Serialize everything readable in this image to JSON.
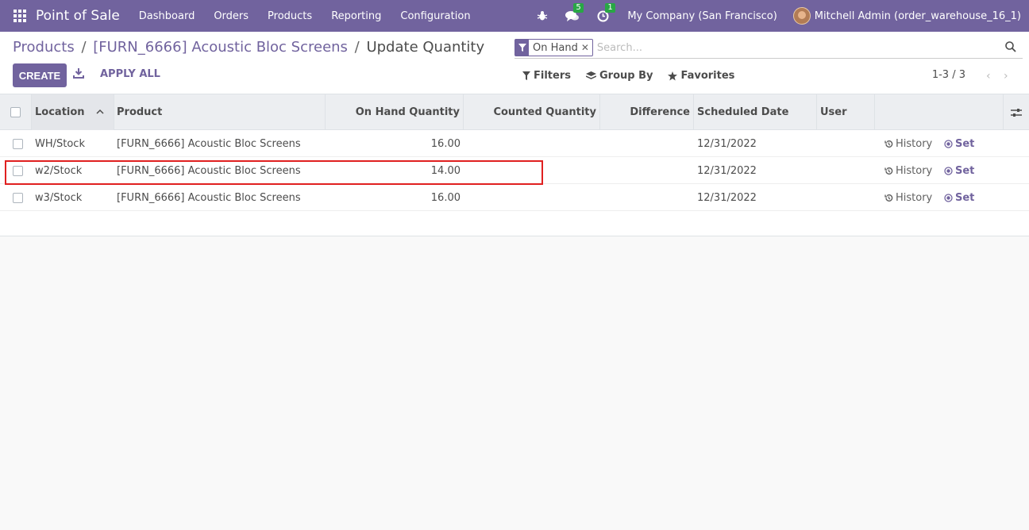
{
  "navbar": {
    "brand": "Point of Sale",
    "menu": [
      "Dashboard",
      "Orders",
      "Products",
      "Reporting",
      "Configuration"
    ],
    "messages_count": "5",
    "activities_count": "1",
    "company": "My Company (San Francisco)",
    "user": "Mitchell Admin (order_warehouse_16_1)"
  },
  "breadcrumb": {
    "items": [
      "Products",
      "[FURN_6666] Acoustic Bloc Screens"
    ],
    "current": "Update Quantity"
  },
  "actions": {
    "create": "CREATE",
    "apply_all": "APPLY ALL"
  },
  "search": {
    "facet": "On Hand",
    "placeholder": "Search..."
  },
  "filters": {
    "filters": "Filters",
    "group_by": "Group By",
    "favorites": "Favorites"
  },
  "pager": {
    "value": "1-3 / 3"
  },
  "table": {
    "columns": {
      "location": "Location",
      "product": "Product",
      "on_hand": "On Hand Quantity",
      "counted": "Counted Quantity",
      "difference": "Difference",
      "scheduled": "Scheduled Date",
      "user": "User"
    },
    "rows": [
      {
        "location": "WH/Stock",
        "product": "[FURN_6666] Acoustic Bloc Screens",
        "on_hand": "16.00",
        "counted": "",
        "difference": "",
        "scheduled": "12/31/2022",
        "user": "",
        "history": "History",
        "set": "Set"
      },
      {
        "location": "w2/Stock",
        "product": "[FURN_6666] Acoustic Bloc Screens",
        "on_hand": "14.00",
        "counted": "",
        "difference": "",
        "scheduled": "12/31/2022",
        "user": "",
        "history": "History",
        "set": "Set"
      },
      {
        "location": "w3/Stock",
        "product": "[FURN_6666] Acoustic Bloc Screens",
        "on_hand": "16.00",
        "counted": "",
        "difference": "",
        "scheduled": "12/31/2022",
        "user": "",
        "history": "History",
        "set": "Set"
      }
    ]
  },
  "colors": {
    "brand": "#71639e",
    "highlight": "#e02020",
    "badge": "#28a745"
  }
}
